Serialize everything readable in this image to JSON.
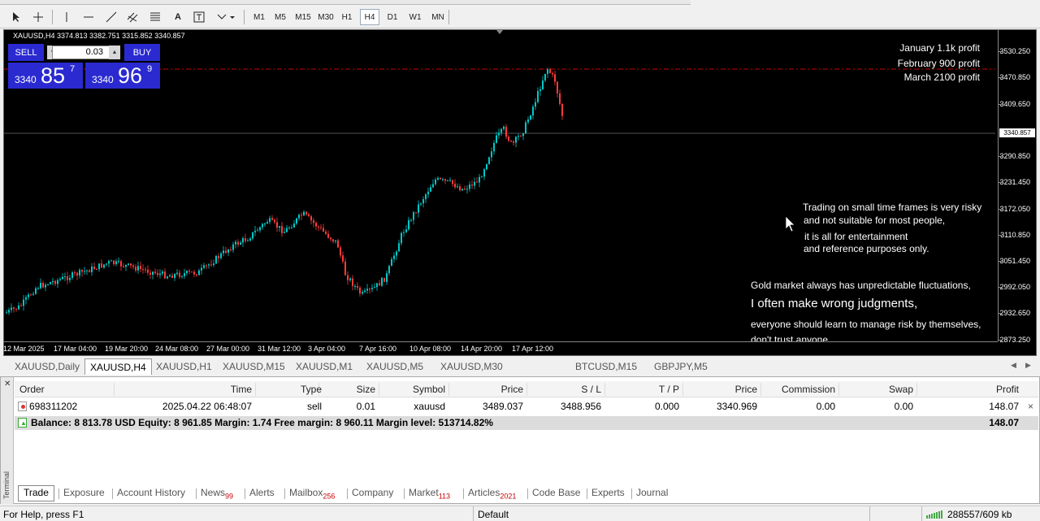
{
  "toolbar": {
    "timeframes": [
      "M1",
      "M5",
      "M15",
      "M30",
      "H1",
      "H4",
      "D1",
      "W1",
      "MN"
    ],
    "active_timeframe": "H4"
  },
  "chart": {
    "title": "XAUUSD,H4  3374.813 3382.751 3315.852 3340.857",
    "trade_panel": {
      "sell_label": "SELL",
      "buy_label": "BUY",
      "lot": "0.03",
      "bid_small": "3340",
      "bid_big": "85",
      "bid_sup": "7",
      "ask_small": "3340",
      "ask_big": "96",
      "ask_sup": "9"
    },
    "profit_notes": [
      "January 1.1k profit",
      "February 900 profit",
      "March 2100 profit"
    ],
    "disclaimer": [
      "Trading on small time frames is very risky",
      "and not suitable for most people,",
      "it is all for entertainment",
      "and reference purposes only.",
      "Gold market always has unpredictable fluctuations,",
      "I often make wrong judgments,",
      "everyone should learn to manage risk by themselves,",
      "don't trust anyone"
    ],
    "price_axis": [
      "3530.250",
      "3470.850",
      "3409.650",
      "3340.857",
      "3290.850",
      "3231.450",
      "3172.050",
      "3110.850",
      "3051.450",
      "2992.050",
      "2932.650",
      "2873.250"
    ],
    "current_price": "3340.857",
    "time_axis": [
      "12 Mar 2025",
      "17 Mar 04:00",
      "19 Mar 20:00",
      "24 Mar 08:00",
      "27 Mar 00:00",
      "31 Mar 12:00",
      "3 Apr 04:00",
      "7 Apr 16:00",
      "10 Apr 08:00",
      "14 Apr 20:00",
      "17 Apr 12:00"
    ],
    "colors": {
      "bull": "#00c8c8",
      "bear": "#ff3b3b",
      "background": "#000000"
    }
  },
  "symbol_tabs": [
    "XAUUSD,Daily",
    "XAUUSD,H4",
    "XAUUSD,H1",
    "XAUUSD,M15",
    "XAUUSD,M1",
    "XAUUSD,M5",
    "XAUUSD,M30",
    "BTCUSD,M15",
    "GBPJPY,M5"
  ],
  "active_symbol_tab": "XAUUSD,H4",
  "terminal": {
    "side_label": "Terminal",
    "headers": [
      "Order",
      "Time",
      "Type",
      "Size",
      "Symbol",
      "Price",
      "S / L",
      "T / P",
      "Price",
      "Commission",
      "Swap",
      "Profit"
    ],
    "order": {
      "order": "698311202",
      "time": "2025.04.22 06:48:07",
      "type": "sell",
      "size": "0.01",
      "symbol": "xauusd",
      "price": "3489.037",
      "sl": "3488.956",
      "tp": "0.000",
      "cur_price": "3340.969",
      "commission": "0.00",
      "swap": "0.00",
      "profit": "148.07"
    },
    "balance_line": "Balance: 8 813.78 USD  Equity: 8 961.85  Margin: 1.74  Free margin: 8 960.11  Margin level: 513714.82%",
    "balance_profit": "148.07",
    "tabs": [
      {
        "label": "Trade",
        "badge": ""
      },
      {
        "label": "Exposure",
        "badge": ""
      },
      {
        "label": "Account History",
        "badge": ""
      },
      {
        "label": "News",
        "badge": "99"
      },
      {
        "label": "Alerts",
        "badge": ""
      },
      {
        "label": "Mailbox",
        "badge": "256"
      },
      {
        "label": "Company",
        "badge": ""
      },
      {
        "label": "Market",
        "badge": "113"
      },
      {
        "label": "Articles",
        "badge": "2021"
      },
      {
        "label": "Code Base",
        "badge": ""
      },
      {
        "label": "Experts",
        "badge": ""
      },
      {
        "label": "Journal",
        "badge": ""
      }
    ]
  },
  "status": {
    "help": "For Help, press F1",
    "profile": "Default",
    "traffic": "288557/609 kb"
  }
}
